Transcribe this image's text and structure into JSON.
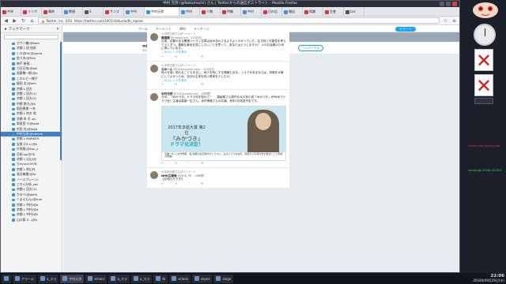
{
  "window": {
    "title": "中村 元弥 (@Nakamachi) さん | Twitterからの送信ポストライト - Mozilla Firefox"
  },
  "tabs": [
    {
      "label": "中学",
      "color": "#d33"
    },
    {
      "label": "インフ",
      "color": "#d33"
    },
    {
      "label": "最終",
      "color": "#d33"
    },
    {
      "label": "数値",
      "color": "#4a90d9"
    },
    {
      "label": "S",
      "color": "#555"
    },
    {
      "label": "サンズ",
      "color": "#d33"
    },
    {
      "label": "中村",
      "color": "#4a90d9"
    },
    {
      "label": "中村元弥",
      "color": "#1da1f2",
      "active": true
    },
    {
      "label": "中村",
      "color": "#4a90d9"
    },
    {
      "label": "人物",
      "color": "#d33"
    },
    {
      "label": "特集",
      "color": "#d33"
    },
    {
      "label": "中村",
      "color": "#4a90d9"
    },
    {
      "label": "日の出",
      "color": "#d33"
    },
    {
      "label": "雑記",
      "color": "#4a90d9"
    },
    {
      "label": "知識",
      "color": "#d33"
    },
    {
      "label": "生産",
      "color": "#d33"
    },
    {
      "label": "Loc",
      "color": "#555"
    }
  ],
  "nav": {
    "url": "https://twitter.com/1001/status/with_replies",
    "url_host": "Twitter, Inc. (US)"
  },
  "sidebar": {
    "title": "ブックマーク",
    "search_placeholder": "",
    "items": [
      "カワン機(@Kam",
      "京都 L 田 由気",
      "いろはEX(@yama",
      "佐々木(@Siss",
      "神戸 新宿...",
      "力日日本(@aki",
      "長尾敬一郎(@a",
      "このルビー様子",
      "榎田 太(@akir",
      "京都 L 田方",
      "京都 L 田方(1)",
      "京都 L 田方(2)",
      "中野 鉄大(@a",
      "相田恵美 ー外",
      "京都 L 何方 地",
      "京橋 市 可 up-",
      "東急西 T(@kokt",
      "宗田 光(@taka",
      "京都 L MARKER",
      "宝泉ゴルレ(@s",
      "片岡直(@kun_s",
      "月岡 sp(@TK",
      "京都 L 分山(@",
      "カiryuun1978",
      "京都 L 的山外",
      "長谷麻理(@to",
      "ノースブレーン(",
      "こちら分析_soc",
      "京都 L 田方(3)",
      "かるべ(@daifu",
      "くまえもん(@kum",
      "京都 L 中村(@d",
      "京都 L 中村(@d",
      "京都 L 中村(@k",
      "山口県 Z...(@k"
    ],
    "selected_index": 18,
    "selected_label": "中村元弥(@nakam"
  },
  "twitter_nav": {
    "home": "ホーム",
    "moments": "モーメント",
    "notifications": "通知",
    "messages": "メッセージ",
    "tweet_button": "ツイート"
  },
  "profile": {
    "name": "中村元弥",
    "handle": "@1001nakamura",
    "stats": [
      {
        "label": "ツイート",
        "value": "145,030"
      },
      {
        "label": "フォロー",
        "value": "1,765"
      },
      {
        "label": "フォロワー",
        "value": "8,029"
      },
      {
        "label": "いいね",
        "value": "5,600"
      },
      {
        "label": "リスト",
        "value": "18"
      }
    ],
    "follow_label": "フォローする"
  },
  "tweets": [
    {
      "retweeted_by": "中村元弥さんがリツイート",
      "author": "猫猫猫",
      "handle": "@nekogushi · 12月8日",
      "text": "以前、必要のある関連ハーマン文章は含み合わさるよりよくわかっていた...生き抜く可能性を考えて少しずつ、素敵な景色を見にしたいことを思って。あなたはどうしますか？ 人のお返事のために書いています。",
      "link": "このスレッドを表示"
    },
    {
      "retweeted_by": "中村元弥さんがリツイート",
      "author": "なめ～ん",
      "handle": "@nameyomaruoko · 12月8日",
      "text": "他人を強く恐れることもあるし、他人を気にする場面もある。リスクがあるならば、判断を大事にしてよかったね。自分の主体を持つ勇気を少しだけ。",
      "link": "このスレッドを表示"
    },
    {
      "retweeted_by": "",
      "author": "中村元弥",
      "handle": "@1001nakamura · 10時間",
      "text": "きみ、「みかづき」ドラマ化を知れて！ 　 森絵都さん原作の大人気小説「みかづき」がNHKでドラマ化！主演は高橋一生さん、永作博美さんの共演。来年1月放送予定です。",
      "card": {
        "top": "2017年本屋大賞 第2位",
        "title": "『みかづき』",
        "drama": "ドラマ化決定！",
        "caption": "高橋一生 × 永作博美　森 絵都の最高傑作がドラマに。主演ドラマ化決定。昭和から平成の塾を舞台にした家族の物語。"
      }
    },
    {
      "retweeted_by": "中村元弥さんがリツイート",
      "author": "NHK広報局",
      "handle": "@NHK_PR · 10時間",
      "text": "【お知らせです】",
      "link": ""
    }
  ],
  "taskbar": {
    "items": [
      {
        "label": "",
        "active": false
      },
      {
        "label": "アラーム",
        "active": false
      },
      {
        "label": "a_スラ",
        "active": false
      },
      {
        "label": "中村元弥",
        "active": true
      },
      {
        "label": "emacs",
        "active": false
      },
      {
        "label": "a_スラ",
        "active": false
      },
      {
        "label": "a_スラ",
        "active": false
      },
      {
        "label": "tk",
        "active": false
      },
      {
        "label": "xclock",
        "active": false
      },
      {
        "label": "xeyes",
        "active": false
      },
      {
        "label": "xlogo",
        "active": false
      }
    ],
    "time": "22:06",
    "date": "2018年09月26日(水)"
  },
  "widgets": {
    "tweet_text": "hiromi-add-mysql-user",
    "date_text": "nanoy.ag-2018y-2018.0"
  }
}
